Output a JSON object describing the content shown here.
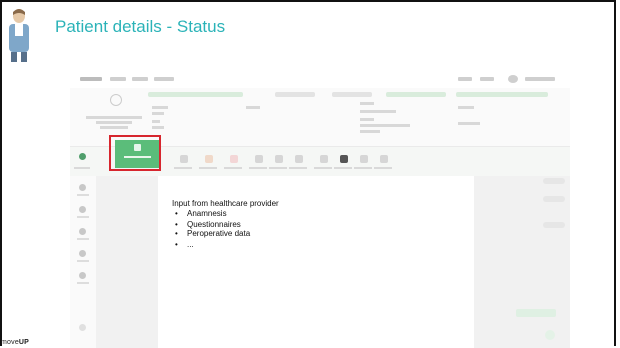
{
  "slide": {
    "title": "Patient details - Status",
    "brand": {
      "prefix": "move",
      "suffix": "UP"
    }
  },
  "screenshot": {
    "highlighted_button": "status",
    "highlight_color": "#d7262e",
    "accent_color": "#5bbd7a"
  },
  "note": {
    "heading": "Input from healthcare provider",
    "items": [
      "Anamnesis",
      "Questionnaires",
      "Peroperative data",
      "..."
    ]
  },
  "colors": {
    "title": "#2bb3b8",
    "highlight": "#d7262e",
    "accent": "#5bbd7a"
  }
}
